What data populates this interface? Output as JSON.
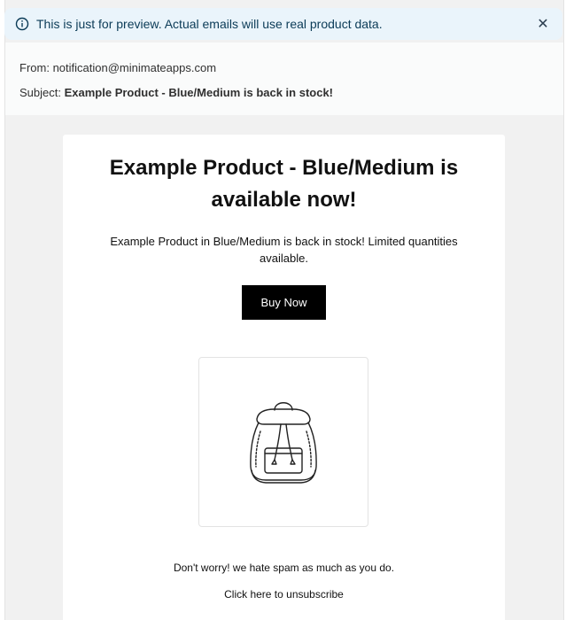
{
  "banner": {
    "text": "This is just for preview. Actual emails will use real product data.",
    "info_icon": "info-icon",
    "close_icon": "close-icon",
    "close_glyph": "✕",
    "bg_color": "#eaf4fb"
  },
  "email_header": {
    "from_label": "From:",
    "from_value": "notification@minimateapps.com",
    "subject_label": "Subject:",
    "subject_value": "Example Product - Blue/Medium is back in stock!"
  },
  "email": {
    "headline": "Example Product - Blue/Medium is available now!",
    "body": "Example Product in Blue/Medium is back in stock! Limited quantities available.",
    "button_label": "Buy Now",
    "product_image_icon": "backpack-icon",
    "spam_note": "Don't worry! we hate spam as much as you do.",
    "unsubscribe_label": "Click here to unsubscribe"
  },
  "colors": {
    "button_bg": "#000000",
    "button_text": "#ffffff",
    "page_bg": "#f1f1f1"
  }
}
